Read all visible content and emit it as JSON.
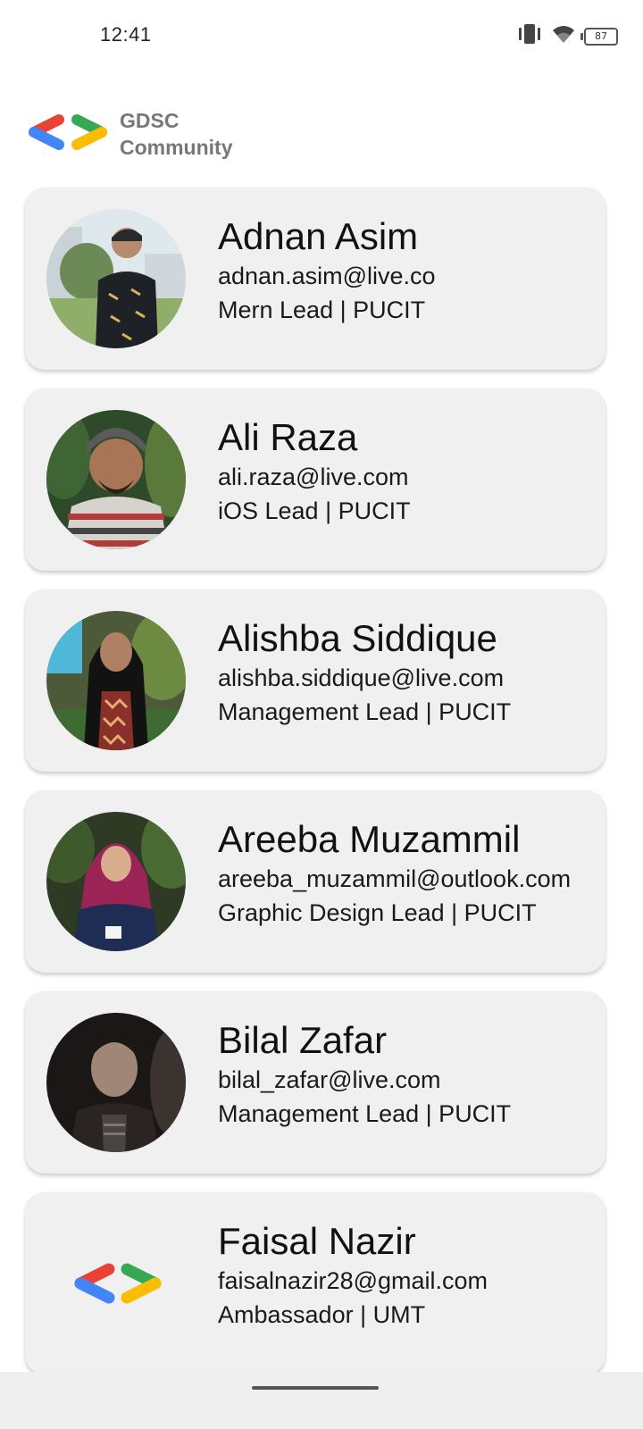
{
  "status_bar": {
    "time": "12:41",
    "battery": "87",
    "icons": [
      "vibrate-icon",
      "wifi-icon",
      "battery-icon"
    ]
  },
  "header": {
    "title_line1": "GDSC",
    "title_line2": "Community",
    "logo": "gdsc-logo-icon"
  },
  "members": [
    {
      "name": "Adnan Asim",
      "email": "adnan.asim@live.co",
      "role": "Mern Lead | PUCIT"
    },
    {
      "name": "Ali Raza",
      "email": "ali.raza@live.com",
      "role": "iOS Lead | PUCIT"
    },
    {
      "name": "Alishba Siddique",
      "email": "alishba.siddique@live.com",
      "role": "Management Lead | PUCIT"
    },
    {
      "name": "Areeba Muzammil",
      "email": "areeba_muzammil@outlook.com",
      "role": "Graphic Design Lead | PUCIT"
    },
    {
      "name": "Bilal Zafar",
      "email": "bilal_zafar@live.com",
      "role": "Management Lead | PUCIT"
    },
    {
      "name": "Faisal Nazir",
      "email": "faisalnazir28@gmail.com",
      "role": "Ambassador | UMT"
    }
  ],
  "colors": {
    "card_bg": "#f0f0f0",
    "logo_red": "#ea4335",
    "logo_blue": "#4285f4",
    "logo_green": "#34a853",
    "logo_yellow": "#fbbc04",
    "header_text": "#777777"
  }
}
